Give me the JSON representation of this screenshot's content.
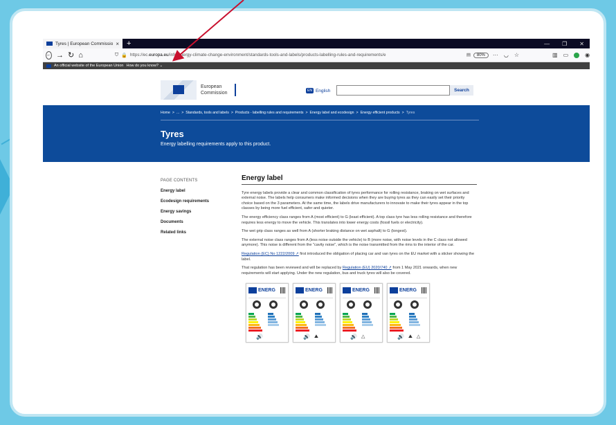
{
  "browser": {
    "tab_title": "Tyres | European Commission",
    "tab_close": "×",
    "new_tab": "+",
    "url_prefix": "https://ec.",
    "url_domain": "europa.eu",
    "url_path": "/info/energy-climate-change-environment/standards-tools-and-labels/products-labelling-rules-and-requirements/e",
    "zoom": "80%",
    "more": "···",
    "win_min": "—",
    "win_max": "❐",
    "win_close": "✕"
  },
  "eubar": {
    "text": "An official website of the European Union",
    "link": "How do you know? ⌄"
  },
  "header": {
    "logo_line1": "European",
    "logo_line2": "Commission",
    "lang_code": "EN",
    "lang_label": "English",
    "search_placeholder": "",
    "search_button": "Search"
  },
  "breadcrumb": {
    "items": [
      "Home",
      ">",
      "...",
      ">",
      "Standards, tools and labels",
      ">",
      "Products - labelling rules and requirements",
      ">",
      "Energy label and ecodesign",
      ">",
      "Energy efficient products",
      ">"
    ],
    "current": "Tyres"
  },
  "banner": {
    "title": "Tyres",
    "subtitle": "Energy labelling requirements apply to this product."
  },
  "sidenav": {
    "header": "PAGE CONTENTS",
    "items": [
      "Energy label",
      "Ecodesign requirements",
      "Energy savings",
      "Documents",
      "Related links"
    ]
  },
  "main": {
    "title": "Energy label",
    "p1": "Tyre energy labels provide a clear and common classification of tyres performance for rolling resistance, braking on wet surfaces and external noise. The labels help consumers make informed decisions when they are buying tyres as they can easily set their priority choice based on the 3 parameters. At the same time, the labels drive manufacturers to innovate to make their tyres appear in the top classes by being more fuel efficient, safer and quieter.",
    "p2": "The energy efficiency class ranges from A (most efficient) to G (least efficient). A top class tyre has less rolling resistance and therefore requires less energy to move the vehicle. This translates into lower energy costs (fossil fuels or electricity).",
    "p3": "The wet grip class ranges as well from A (shorter braking distance on wet asphalt) to G (longest).",
    "p4": "The external noise class ranges from A (less noise outside the vehicle) to B (more noise, with noise levels in the C class not allowed anymore). This noise is different from the \"cavity noise\", which is the noise transmitted from the rims to the interior of the car.",
    "p5_link": "Regulation (EC) No 1222/2009 ↗",
    "p5_rest": " first introduced  the obligation of placing car and van tyres on the EU market with a sticker showing the label.",
    "p6_start": "That regulation has been reviewed and will be replaced by ",
    "p6_link": "Regulation (EU) 2020/740 ↗",
    "p6_rest": " from 1 May 2021 onwards, when new requirements will start applying. Under the new regulation, bus and truck tyres will also be covered.",
    "label_brand": "ENERG"
  },
  "colors": {
    "banner": "#0d4b9a",
    "eu_blue": "#0c3f9b",
    "arrow": "#c8102e"
  }
}
